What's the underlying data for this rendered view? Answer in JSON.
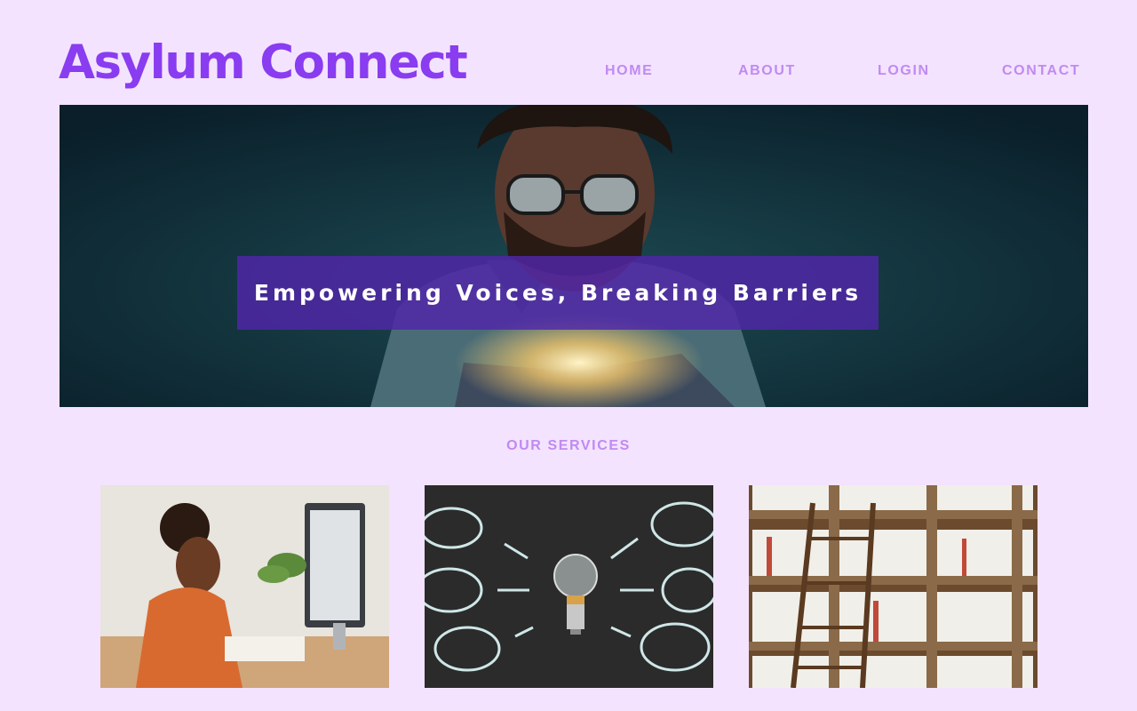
{
  "header": {
    "logo": "Asylum Connect",
    "nav": [
      {
        "label": "HOME"
      },
      {
        "label": "ABOUT"
      },
      {
        "label": "LOGIN"
      },
      {
        "label": "CONTACT"
      }
    ]
  },
  "hero": {
    "tagline": "Empowering Voices, Breaking Barriers",
    "image": "person-reading-glowing-book-photo"
  },
  "services": {
    "title": "OUR SERVICES",
    "cards": [
      {
        "image": "woman-working-at-computer-photo"
      },
      {
        "image": "lightbulb-chalkboard-photo"
      },
      {
        "image": "library-bookshelf-ladder-photo"
      }
    ]
  },
  "colors": {
    "background": "#f3e3ff",
    "brand": "#8a3cf0",
    "nav": "#c08af2",
    "banner": "#5026aa"
  }
}
